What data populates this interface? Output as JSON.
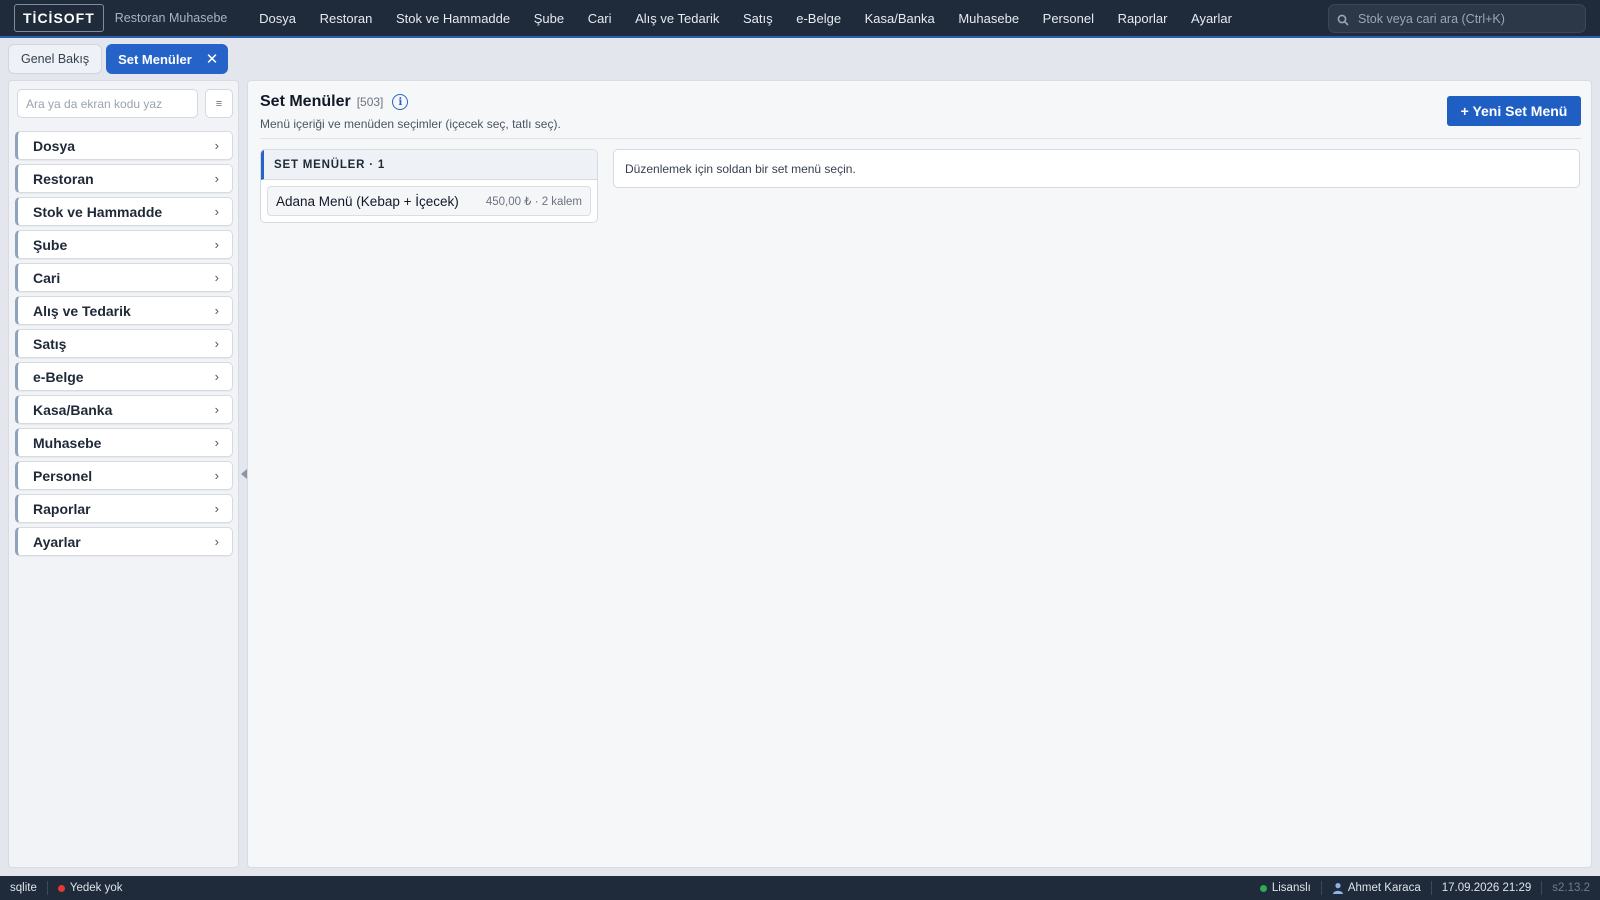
{
  "topbar": {
    "logo": "TİCİSOFT",
    "app_name": "Restoran Muhasebe",
    "menu": [
      "Dosya",
      "Restoran",
      "Stok ve Hammadde",
      "Şube",
      "Cari",
      "Alış ve Tedarik",
      "Satış",
      "e-Belge",
      "Kasa/Banka",
      "Muhasebe",
      "Personel",
      "Raporlar",
      "Ayarlar"
    ],
    "search_placeholder": "Stok veya cari ara (Ctrl+K)",
    "search_icon": "search-icon"
  },
  "tabs": {
    "inactive_label": "Genel Bakış",
    "active_label": "Set Menüler",
    "close_glyph": "✕"
  },
  "sidebar": {
    "search_placeholder": "Ara ya da ekran kodu yaz",
    "filter_glyph": "≡",
    "items": [
      {
        "label": "Dosya"
      },
      {
        "label": "Restoran"
      },
      {
        "label": "Stok ve Hammadde"
      },
      {
        "label": "Şube"
      },
      {
        "label": "Cari"
      },
      {
        "label": "Alış ve Tedarik"
      },
      {
        "label": "Satış"
      },
      {
        "label": "e-Belge"
      },
      {
        "label": "Kasa/Banka"
      },
      {
        "label": "Muhasebe"
      },
      {
        "label": "Personel"
      },
      {
        "label": "Raporlar"
      },
      {
        "label": "Ayarlar"
      }
    ],
    "chevron": "›"
  },
  "main": {
    "title": "Set Menüler",
    "code": "[503]",
    "info_glyph": "i",
    "subtitle": "Menü içeriği ve menüden seçimler (içecek seç, tatlı seç).",
    "new_button": "+ Yeni Set Menü",
    "list_header": "SET MENÜLER · 1",
    "rows": [
      {
        "name": "Adana Menü (Kebap + İçecek)",
        "meta": "450,00 ₺ · 2 kalem"
      }
    ],
    "detail_empty": "Düzenlemek için soldan bir set menü seçin."
  },
  "statusbar": {
    "db": "sqlite",
    "backup": "Yedek yok",
    "license": "Lisanslı",
    "user": "Ahmet Karaca",
    "datetime": "17.09.2026 21:29",
    "version": "s2.13.2"
  },
  "colors": {
    "topbar_bg": "#1f2a3a",
    "accent": "#2563c9",
    "backup_dot": "#e53935",
    "license_dot": "#2eab52"
  }
}
